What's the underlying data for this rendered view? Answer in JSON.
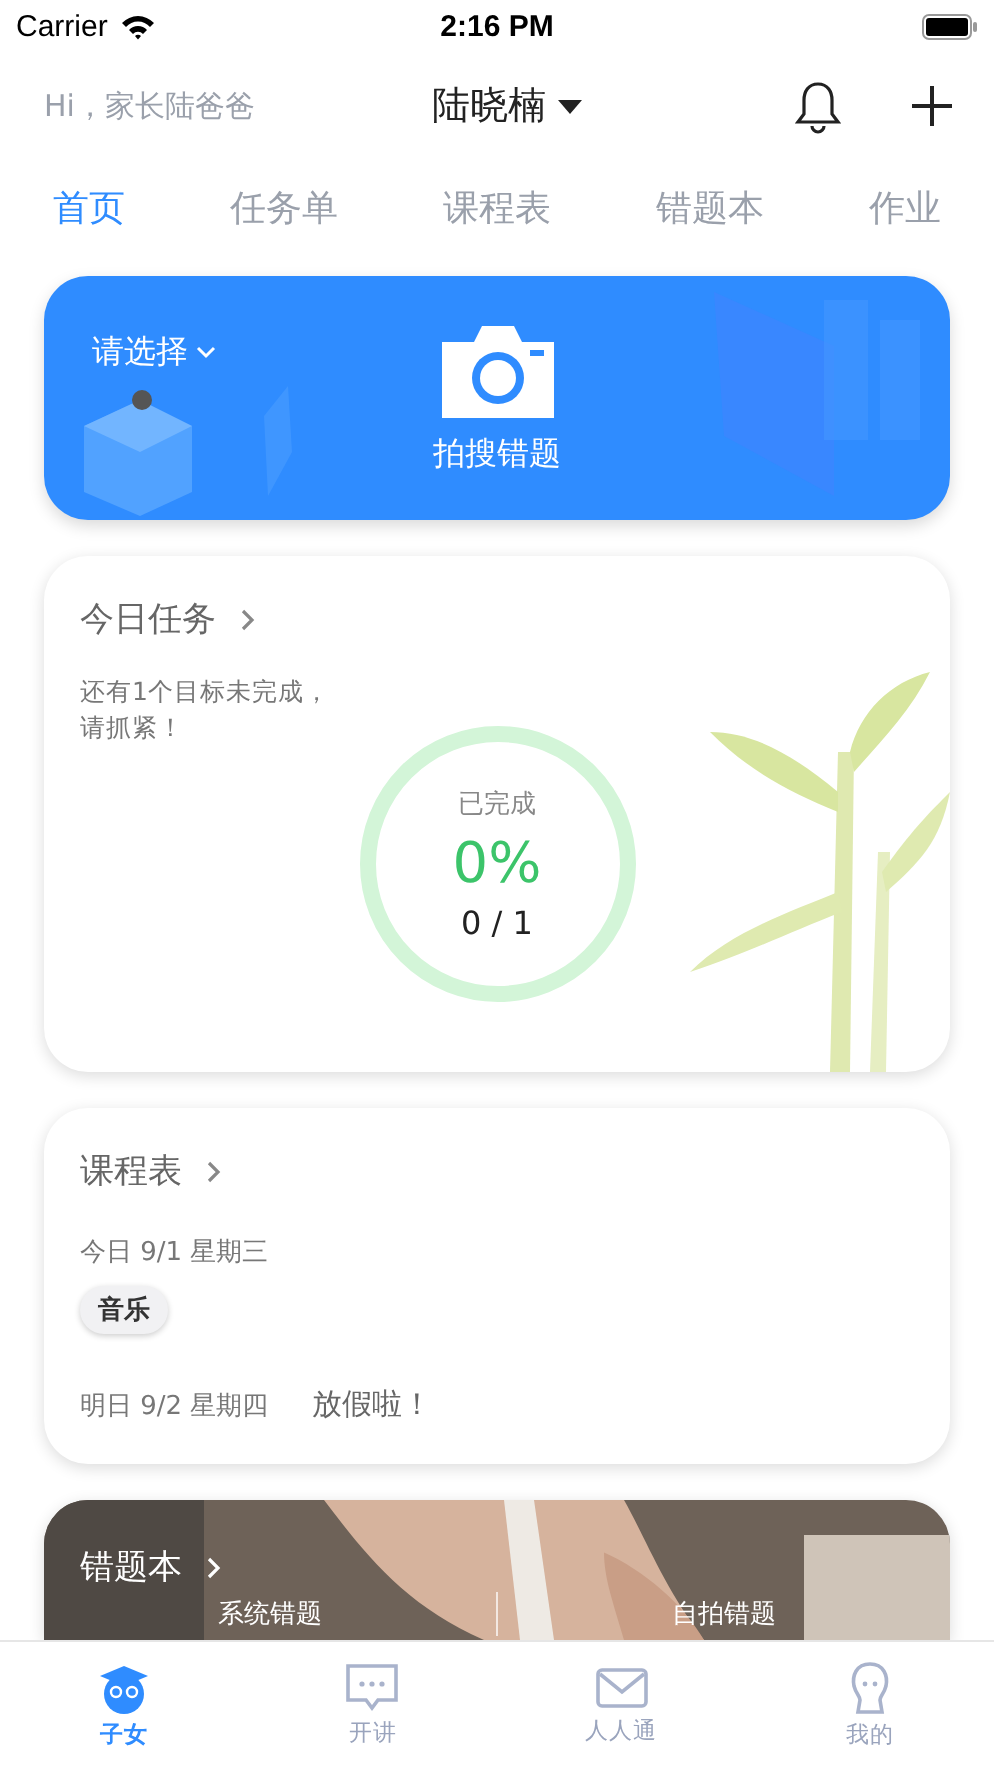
{
  "status_bar": {
    "carrier": "Carrier",
    "time": "2:16 PM"
  },
  "header": {
    "greeting": "Hi，家长陆爸爸",
    "child_name": "陆晓楠"
  },
  "tabs": [
    {
      "label": "首页",
      "selected": true
    },
    {
      "label": "任务单",
      "selected": false
    },
    {
      "label": "课程表",
      "selected": false
    },
    {
      "label": "错题本",
      "selected": false
    },
    {
      "label": "作业",
      "selected": false
    }
  ],
  "banner": {
    "selector": "请选择",
    "action": "拍搜错题"
  },
  "today_tasks": {
    "title": "今日任务",
    "message": [
      "还有1个目标未完成，",
      "请抓紧！"
    ],
    "ring_label": "已完成",
    "percent": "0%",
    "count": "0 / 1",
    "level": 0
  },
  "schedule": {
    "title": "课程表",
    "today_label": "今日 9/1 星期三",
    "today_courses": [
      "音乐"
    ],
    "tomorrow_label": "明日 9/2 星期四",
    "tomorrow_note": "放假啦！"
  },
  "mistakes": {
    "title": "错题本",
    "options": [
      "系统错题",
      "自拍错题"
    ]
  },
  "bottom_nav": [
    {
      "label": "子女",
      "kind": "child",
      "selected": true
    },
    {
      "label": "开讲",
      "kind": "chat",
      "selected": false
    },
    {
      "label": "人人通",
      "kind": "mail",
      "selected": false
    },
    {
      "label": "我的",
      "kind": "profile",
      "selected": false
    }
  ]
}
